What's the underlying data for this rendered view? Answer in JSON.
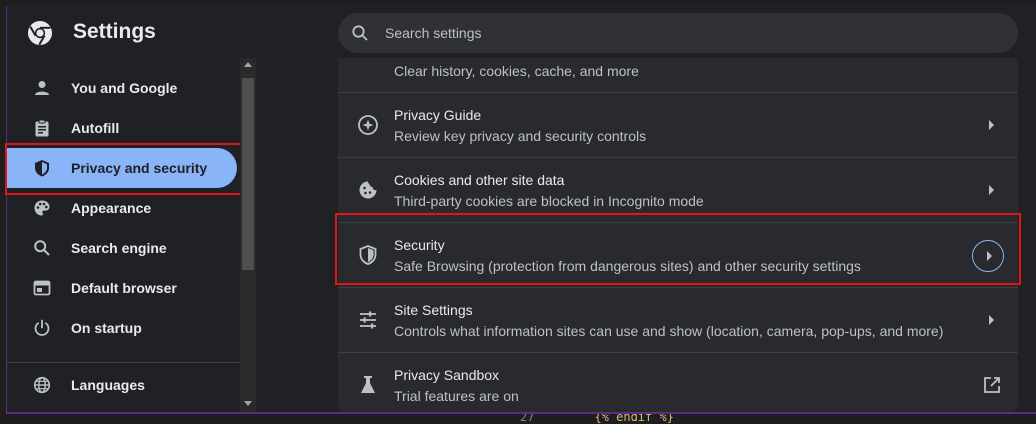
{
  "app": {
    "title": "Settings"
  },
  "search": {
    "placeholder": "Search settings"
  },
  "sidebar": {
    "items": [
      {
        "label": "You and Google",
        "icon": "person-icon"
      },
      {
        "label": "Autofill",
        "icon": "clipboard-icon"
      },
      {
        "label": "Privacy and security",
        "icon": "shield-icon",
        "active": true
      },
      {
        "label": "Appearance",
        "icon": "palette-icon"
      },
      {
        "label": "Search engine",
        "icon": "search-icon"
      },
      {
        "label": "Default browser",
        "icon": "browser-window-icon"
      },
      {
        "label": "On startup",
        "icon": "power-icon"
      },
      {
        "label": "Languages",
        "icon": "globe-icon"
      }
    ]
  },
  "privacy": {
    "partial_subtitle": "Clear history, cookies, cache, and more",
    "rows": [
      {
        "title": "Privacy Guide",
        "subtitle": "Review key privacy and security controls",
        "icon": "compass-icon"
      },
      {
        "title": "Cookies and other site data",
        "subtitle": "Third-party cookies are blocked in Incognito mode",
        "icon": "cookie-icon"
      },
      {
        "title": "Security",
        "subtitle": "Safe Browsing (protection from dangerous sites) and other security settings",
        "icon": "shield-outline-icon"
      },
      {
        "title": "Site Settings",
        "subtitle": "Controls what information sites can use and show (location, camera, pop-ups, and more)",
        "icon": "sliders-icon"
      },
      {
        "title": "Privacy Sandbox",
        "subtitle": "Trial features are on",
        "icon": "flask-icon"
      }
    ]
  },
  "background": {
    "line_number": "27",
    "code": "{% endif %}"
  },
  "colors": {
    "accent": "#8ab4f8",
    "highlight": "#e0151b",
    "surface": "#292a2d",
    "window": "#202124"
  }
}
